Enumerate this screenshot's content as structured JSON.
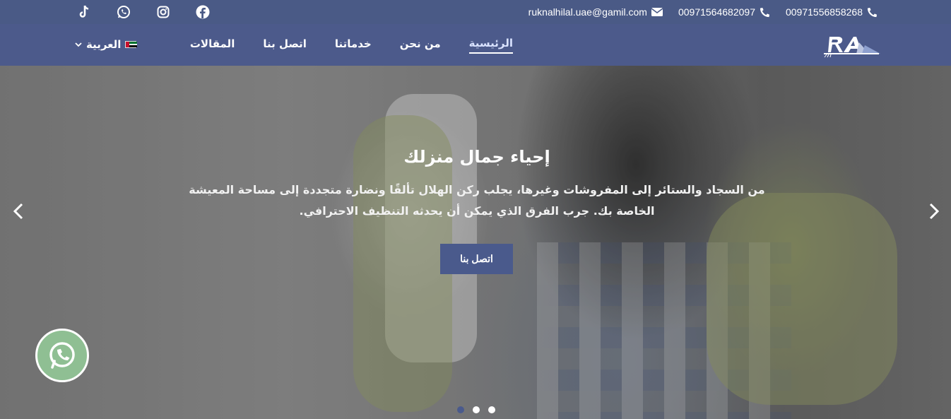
{
  "topbar": {
    "social_icons": [
      "tiktok-icon",
      "whatsapp-icon",
      "instagram-icon",
      "facebook-icon"
    ],
    "email": "ruknalhilal.uae@gamil.com",
    "phone_1": "00971564682097",
    "phone_2": "00971556858268"
  },
  "nav": {
    "items": [
      {
        "label": "الرئيسية",
        "active": true
      },
      {
        "label": "من نحن"
      },
      {
        "label": "خدماتنا"
      },
      {
        "label": "اتصل بنا"
      },
      {
        "label": "المقالات"
      }
    ],
    "language": "العربية"
  },
  "hero": {
    "title": "إحياء جمال منزلك",
    "text_line_1": "من السجاد والستائر إلى المفروشات وغيرها، يجلب ركن الهلال تألقًا ونضارة متجددة إلى مساحة المعيشة",
    "text_line_2": "الخاصة بك. جرب الفرق الذي يمكن أن يحدثه التنظيف الاحترافي.",
    "cta_label": "اتصل بنا",
    "slides": 3,
    "active_slide": 1
  },
  "colors": {
    "topbar": "#4a5a86",
    "navbar": "#4c5a8b",
    "accent": "#4a5a8c",
    "whatsapp": "#8fbf93"
  }
}
